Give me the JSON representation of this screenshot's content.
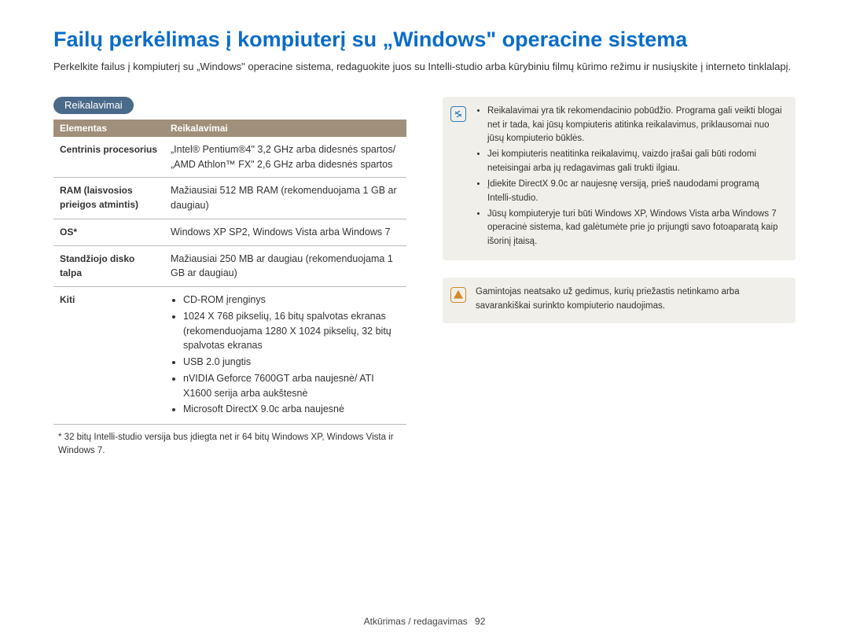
{
  "title": "Failų perkėlimas į kompiuterį su „Windows\" operacine sistema",
  "intro": "Perkelkite failus į kompiuterį su „Windows\" operacine sistema, redaguokite juos su Intelli-studio arba kūrybiniu filmų kūrimo režimu ir nusiųskite į interneto tinklalapį.",
  "badge": "Reikalavimai",
  "table": {
    "header": {
      "col1": "Elementas",
      "col2": "Reikalavimai"
    },
    "rows": {
      "cpu": {
        "label": "Centrinis procesorius",
        "value": "„Intel® Pentium®4\" 3,2 GHz arba didesnės spartos/ „AMD Athlon™ FX\" 2,6 GHz arba didesnės spartos"
      },
      "ram": {
        "label": "RAM (laisvosios prieigos atmintis)",
        "value": "Mažiausiai 512 MB RAM (rekomenduojama 1 GB ar daugiau)"
      },
      "os": {
        "label": "OS*",
        "value": "Windows XP SP2, Windows Vista arba Windows 7"
      },
      "hdd": {
        "label": "Standžiojo disko talpa",
        "value": "Mažiausiai 250 MB ar daugiau (rekomenduojama 1 GB ar daugiau)"
      },
      "other": {
        "label": "Kiti",
        "items": {
          "i1": "CD-ROM įrenginys",
          "i2": "1024 X 768 pikselių, 16 bitų spalvotas ekranas (rekomenduojama 1280 X 1024 pikselių, 32 bitų spalvotas ekranas",
          "i3": "USB 2.0 jungtis",
          "i4": "nVIDIA Geforce 7600GT arba naujesnė/ ATI X1600 serija arba aukštesnė",
          "i5": "Microsoft DirectX 9.0c arba naujesnė"
        }
      }
    }
  },
  "footnote": "* 32 bitų Intelli-studio versija bus įdiegta net ir 64 bitų Windows XP, Windows Vista ir Windows 7.",
  "info_note": {
    "i1": "Reikalavimai yra tik rekomendacinio pobūdžio. Programa gali veikti blogai net ir tada, kai jūsų kompiuteris atitinka reikalavimus, priklausomai nuo jūsų kompiuterio būklės.",
    "i2": "Jei kompiuteris neatitinka reikalavimų, vaizdo įrašai gali būti rodomi neteisingai arba jų redagavimas gali trukti ilgiau.",
    "i3": "Įdiekite DirectX 9.0c ar naujesnę versiją, prieš naudodami programą Intelli-studio.",
    "i4": "Jūsų kompiuteryje turi būti Windows XP, Windows Vista arba Windows 7 operacinė sistema, kad galėtumėte prie jo prijungti savo fotoaparatą kaip išorinį įtaisą."
  },
  "warn_note": "Gamintojas neatsako už gedimus, kurių priežastis netinkamo arba savarankiškai surinkto kompiuterio naudojimas.",
  "footer": {
    "section": "Atkūrimas / redagavimas",
    "page": "92"
  }
}
